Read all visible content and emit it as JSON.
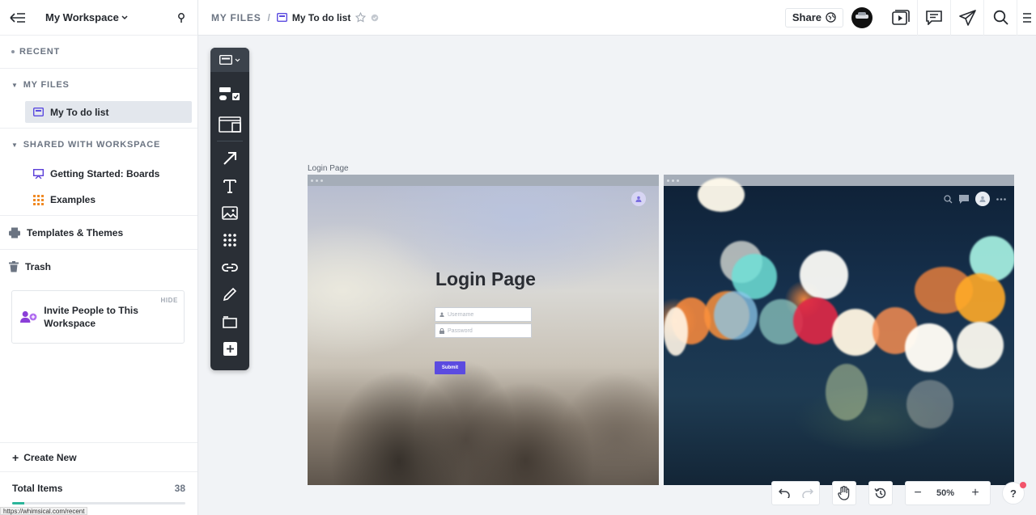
{
  "sidebar": {
    "workspace_name": "My Workspace",
    "recent_label": "RECENT",
    "my_files_label": "MY FILES",
    "my_files_items": [
      {
        "label": "My To do list"
      }
    ],
    "shared_label": "SHARED WITH WORKSPACE",
    "shared_items": [
      {
        "label": "Getting Started: Boards"
      },
      {
        "label": "Examples"
      }
    ],
    "templates_label": "Templates & Themes",
    "trash_label": "Trash",
    "invite": {
      "hide_label": "HIDE",
      "text": "Invite People to This Workspace"
    },
    "create_new_label": "Create New",
    "total_items_label": "Total Items",
    "total_items_count": "38",
    "usage_fraction": 0.07
  },
  "status_bar_url": "https://whimsical.com/recent",
  "header": {
    "breadcrumb_root": "MY FILES",
    "breadcrumb_separator": "/",
    "doc_title": "My To do list",
    "share_label": "Share"
  },
  "canvas": {
    "frame_label": "Login Page",
    "login_title": "Login Page",
    "username_placeholder": "Username",
    "password_placeholder": "Password",
    "submit_label": "Submit"
  },
  "zoom": {
    "level": "50%",
    "minus": "−",
    "plus": "+"
  },
  "help_label": "?",
  "colors": {
    "accent": "#5b4be0",
    "progress": "#2bb59a",
    "toolbar": "#2a2f36",
    "notification": "#f2546b"
  }
}
